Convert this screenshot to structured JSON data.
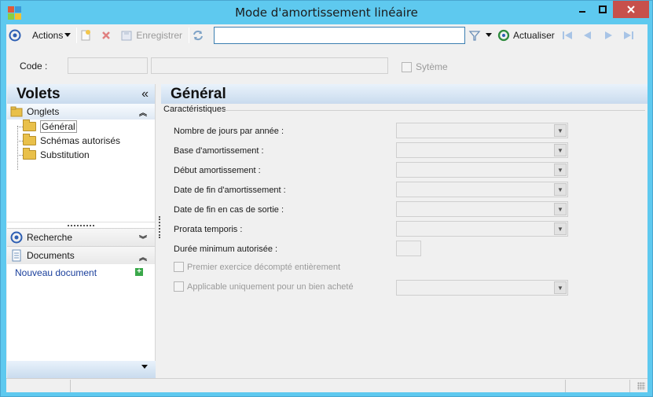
{
  "window": {
    "title": "Mode d'amortissement linéaire",
    "controls": {
      "minimize": "—",
      "maximize": "□",
      "close": "✕"
    }
  },
  "toolbar": {
    "actions_label": "Actions",
    "save_label": "Enregistrer",
    "search_value": "",
    "refresh_label": "Actualiser"
  },
  "record": {
    "code_label": "Code :",
    "code_value": "",
    "name_value": "",
    "system_label": "Sytème",
    "system_checked": false
  },
  "left_panel": {
    "title": "Volets",
    "collapse_glyph": "«",
    "tabs_group": {
      "label": "Onglets",
      "items": [
        {
          "label": "Général",
          "selected": true
        },
        {
          "label": "Schémas autorisés",
          "selected": false
        },
        {
          "label": "Substitution",
          "selected": false
        }
      ]
    },
    "search_label": "Recherche",
    "documents_label": "Documents",
    "new_document_label": "Nouveau document"
  },
  "main": {
    "title": "Général",
    "section_title": "Caractéristiques",
    "fields": [
      {
        "label": "Nombre de jours par année :",
        "value": ""
      },
      {
        "label": "Base d'amortissement :",
        "value": ""
      },
      {
        "label": "Début amortissement :",
        "value": ""
      },
      {
        "label": "Date de fin d'amortissement :",
        "value": ""
      },
      {
        "label": "Date de fin en cas de sortie :",
        "value": ""
      },
      {
        "label": "Prorata temporis :",
        "value": ""
      },
      {
        "label": "Durée minimum autorisée :",
        "value": ""
      }
    ],
    "first_year_label": "Premier exercice décompté entièrement",
    "first_year_checked": false,
    "bought_only_label": "Applicable uniquement pour un bien acheté",
    "bought_only_checked": false,
    "bought_only_value": ""
  },
  "colors": {
    "title_bar": "#5ec9ef",
    "header_gradient": "#c9dbee",
    "link": "#1a3f9c",
    "close_button": "#c7504b"
  }
}
